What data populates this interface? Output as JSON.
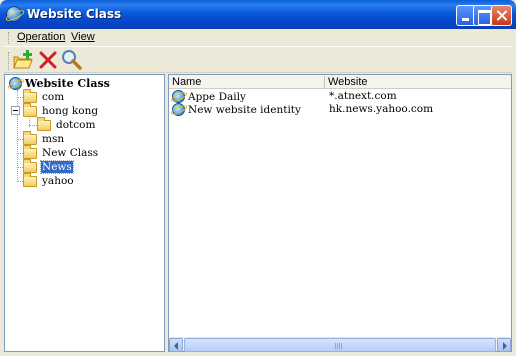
{
  "window": {
    "title": "Website Class",
    "icon": "internet-explorer-icon"
  },
  "menu": {
    "items": [
      {
        "label": "Operation"
      },
      {
        "label": "View"
      }
    ]
  },
  "toolbar": {
    "buttons": [
      {
        "icon": "new-folder-icon"
      },
      {
        "icon": "delete-icon"
      },
      {
        "icon": "search-icon"
      }
    ]
  },
  "tree": {
    "root": "Website Class",
    "nodes": [
      {
        "label": "com"
      },
      {
        "label": "hong kong"
      },
      {
        "label": "dotcom"
      },
      {
        "label": "msn"
      },
      {
        "label": "New Class"
      },
      {
        "label": "News"
      },
      {
        "label": "yahoo"
      }
    ],
    "selected": "News"
  },
  "list": {
    "columns": [
      "Name",
      "Website"
    ],
    "rows": [
      {
        "name": "Appe Daily",
        "website": "*.atnext.com"
      },
      {
        "name": "New website identity",
        "website": "hk.news.yahoo.com"
      }
    ]
  },
  "colors": {
    "titlebar": "#0b58d8",
    "selection": "#316ac5",
    "window_bg": "#ece9d8"
  }
}
